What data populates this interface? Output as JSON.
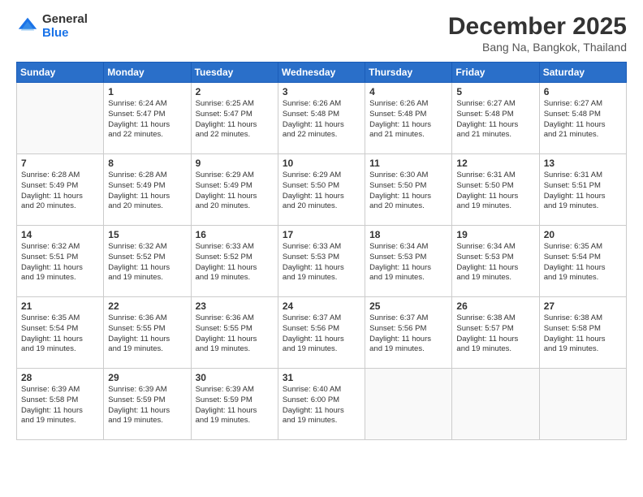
{
  "logo": {
    "general": "General",
    "blue": "Blue"
  },
  "header": {
    "month": "December 2025",
    "location": "Bang Na, Bangkok, Thailand"
  },
  "weekdays": [
    "Sunday",
    "Monday",
    "Tuesday",
    "Wednesday",
    "Thursday",
    "Friday",
    "Saturday"
  ],
  "weeks": [
    [
      {
        "day": "",
        "sunrise": "",
        "sunset": "",
        "daylight": "",
        "empty": true
      },
      {
        "day": "1",
        "sunrise": "Sunrise: 6:24 AM",
        "sunset": "Sunset: 5:47 PM",
        "daylight": "Daylight: 11 hours and 22 minutes."
      },
      {
        "day": "2",
        "sunrise": "Sunrise: 6:25 AM",
        "sunset": "Sunset: 5:47 PM",
        "daylight": "Daylight: 11 hours and 22 minutes."
      },
      {
        "day": "3",
        "sunrise": "Sunrise: 6:26 AM",
        "sunset": "Sunset: 5:48 PM",
        "daylight": "Daylight: 11 hours and 22 minutes."
      },
      {
        "day": "4",
        "sunrise": "Sunrise: 6:26 AM",
        "sunset": "Sunset: 5:48 PM",
        "daylight": "Daylight: 11 hours and 21 minutes."
      },
      {
        "day": "5",
        "sunrise": "Sunrise: 6:27 AM",
        "sunset": "Sunset: 5:48 PM",
        "daylight": "Daylight: 11 hours and 21 minutes."
      },
      {
        "day": "6",
        "sunrise": "Sunrise: 6:27 AM",
        "sunset": "Sunset: 5:48 PM",
        "daylight": "Daylight: 11 hours and 21 minutes."
      }
    ],
    [
      {
        "day": "7",
        "sunrise": "Sunrise: 6:28 AM",
        "sunset": "Sunset: 5:49 PM",
        "daylight": "Daylight: 11 hours and 20 minutes."
      },
      {
        "day": "8",
        "sunrise": "Sunrise: 6:28 AM",
        "sunset": "Sunset: 5:49 PM",
        "daylight": "Daylight: 11 hours and 20 minutes."
      },
      {
        "day": "9",
        "sunrise": "Sunrise: 6:29 AM",
        "sunset": "Sunset: 5:49 PM",
        "daylight": "Daylight: 11 hours and 20 minutes."
      },
      {
        "day": "10",
        "sunrise": "Sunrise: 6:29 AM",
        "sunset": "Sunset: 5:50 PM",
        "daylight": "Daylight: 11 hours and 20 minutes."
      },
      {
        "day": "11",
        "sunrise": "Sunrise: 6:30 AM",
        "sunset": "Sunset: 5:50 PM",
        "daylight": "Daylight: 11 hours and 20 minutes."
      },
      {
        "day": "12",
        "sunrise": "Sunrise: 6:31 AM",
        "sunset": "Sunset: 5:50 PM",
        "daylight": "Daylight: 11 hours and 19 minutes."
      },
      {
        "day": "13",
        "sunrise": "Sunrise: 6:31 AM",
        "sunset": "Sunset: 5:51 PM",
        "daylight": "Daylight: 11 hours and 19 minutes."
      }
    ],
    [
      {
        "day": "14",
        "sunrise": "Sunrise: 6:32 AM",
        "sunset": "Sunset: 5:51 PM",
        "daylight": "Daylight: 11 hours and 19 minutes."
      },
      {
        "day": "15",
        "sunrise": "Sunrise: 6:32 AM",
        "sunset": "Sunset: 5:52 PM",
        "daylight": "Daylight: 11 hours and 19 minutes."
      },
      {
        "day": "16",
        "sunrise": "Sunrise: 6:33 AM",
        "sunset": "Sunset: 5:52 PM",
        "daylight": "Daylight: 11 hours and 19 minutes."
      },
      {
        "day": "17",
        "sunrise": "Sunrise: 6:33 AM",
        "sunset": "Sunset: 5:53 PM",
        "daylight": "Daylight: 11 hours and 19 minutes."
      },
      {
        "day": "18",
        "sunrise": "Sunrise: 6:34 AM",
        "sunset": "Sunset: 5:53 PM",
        "daylight": "Daylight: 11 hours and 19 minutes."
      },
      {
        "day": "19",
        "sunrise": "Sunrise: 6:34 AM",
        "sunset": "Sunset: 5:53 PM",
        "daylight": "Daylight: 11 hours and 19 minutes."
      },
      {
        "day": "20",
        "sunrise": "Sunrise: 6:35 AM",
        "sunset": "Sunset: 5:54 PM",
        "daylight": "Daylight: 11 hours and 19 minutes."
      }
    ],
    [
      {
        "day": "21",
        "sunrise": "Sunrise: 6:35 AM",
        "sunset": "Sunset: 5:54 PM",
        "daylight": "Daylight: 11 hours and 19 minutes."
      },
      {
        "day": "22",
        "sunrise": "Sunrise: 6:36 AM",
        "sunset": "Sunset: 5:55 PM",
        "daylight": "Daylight: 11 hours and 19 minutes."
      },
      {
        "day": "23",
        "sunrise": "Sunrise: 6:36 AM",
        "sunset": "Sunset: 5:55 PM",
        "daylight": "Daylight: 11 hours and 19 minutes."
      },
      {
        "day": "24",
        "sunrise": "Sunrise: 6:37 AM",
        "sunset": "Sunset: 5:56 PM",
        "daylight": "Daylight: 11 hours and 19 minutes."
      },
      {
        "day": "25",
        "sunrise": "Sunrise: 6:37 AM",
        "sunset": "Sunset: 5:56 PM",
        "daylight": "Daylight: 11 hours and 19 minutes."
      },
      {
        "day": "26",
        "sunrise": "Sunrise: 6:38 AM",
        "sunset": "Sunset: 5:57 PM",
        "daylight": "Daylight: 11 hours and 19 minutes."
      },
      {
        "day": "27",
        "sunrise": "Sunrise: 6:38 AM",
        "sunset": "Sunset: 5:58 PM",
        "daylight": "Daylight: 11 hours and 19 minutes."
      }
    ],
    [
      {
        "day": "28",
        "sunrise": "Sunrise: 6:39 AM",
        "sunset": "Sunset: 5:58 PM",
        "daylight": "Daylight: 11 hours and 19 minutes."
      },
      {
        "day": "29",
        "sunrise": "Sunrise: 6:39 AM",
        "sunset": "Sunset: 5:59 PM",
        "daylight": "Daylight: 11 hours and 19 minutes."
      },
      {
        "day": "30",
        "sunrise": "Sunrise: 6:39 AM",
        "sunset": "Sunset: 5:59 PM",
        "daylight": "Daylight: 11 hours and 19 minutes."
      },
      {
        "day": "31",
        "sunrise": "Sunrise: 6:40 AM",
        "sunset": "Sunset: 6:00 PM",
        "daylight": "Daylight: 11 hours and 19 minutes."
      },
      {
        "day": "",
        "sunrise": "",
        "sunset": "",
        "daylight": "",
        "empty": true
      },
      {
        "day": "",
        "sunrise": "",
        "sunset": "",
        "daylight": "",
        "empty": true
      },
      {
        "day": "",
        "sunrise": "",
        "sunset": "",
        "daylight": "",
        "empty": true
      }
    ]
  ]
}
